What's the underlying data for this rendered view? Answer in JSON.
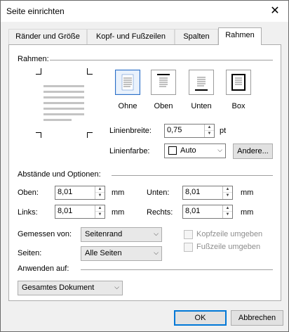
{
  "window": {
    "title": "Seite einrichten",
    "close_glyph": "✕"
  },
  "tabs": [
    {
      "label": "Ränder und Größe"
    },
    {
      "label": "Kopf- und Fußzeilen"
    },
    {
      "label": "Spalten"
    },
    {
      "label": "Rahmen"
    }
  ],
  "active_tab": "Rahmen",
  "border": {
    "section_label": "Rahmen:",
    "presets": [
      {
        "label": "Ohne",
        "icon": "border-none-icon",
        "selected": true
      },
      {
        "label": "Oben",
        "icon": "border-top-icon",
        "selected": false
      },
      {
        "label": "Unten",
        "icon": "border-bottom-icon",
        "selected": false
      },
      {
        "label": "Box",
        "icon": "border-box-icon",
        "selected": false
      }
    ],
    "line_width_label": "Linienbreite:",
    "line_width_value": "0,75",
    "line_width_unit": "pt",
    "line_color_label": "Linienfarbe:",
    "line_color_value": "Auto",
    "more_button": "Andere..."
  },
  "spacing": {
    "section_label": "Abstände und Optionen:",
    "top_label": "Oben:",
    "top_value": "8,01",
    "top_unit": "mm",
    "bottom_label": "Unten:",
    "bottom_value": "8,01",
    "bottom_unit": "mm",
    "left_label": "Links:",
    "left_value": "8,01",
    "left_unit": "mm",
    "right_label": "Rechts:",
    "right_value": "8,01",
    "right_unit": "mm",
    "measured_from_label": "Gemessen von:",
    "measured_from_value": "Seitenrand",
    "pages_label": "Seiten:",
    "pages_value": "Alle Seiten",
    "header_check_label": "Kopfzeile umgeben",
    "footer_check_label": "Fußzeile umgeben"
  },
  "apply": {
    "section_label": "Anwenden auf:",
    "value": "Gesamtes Dokument"
  },
  "footer": {
    "ok": "OK",
    "cancel": "Abbrechen"
  },
  "colors": {
    "accent": "#0078d7",
    "selected_preset": "#2b6fc7"
  }
}
